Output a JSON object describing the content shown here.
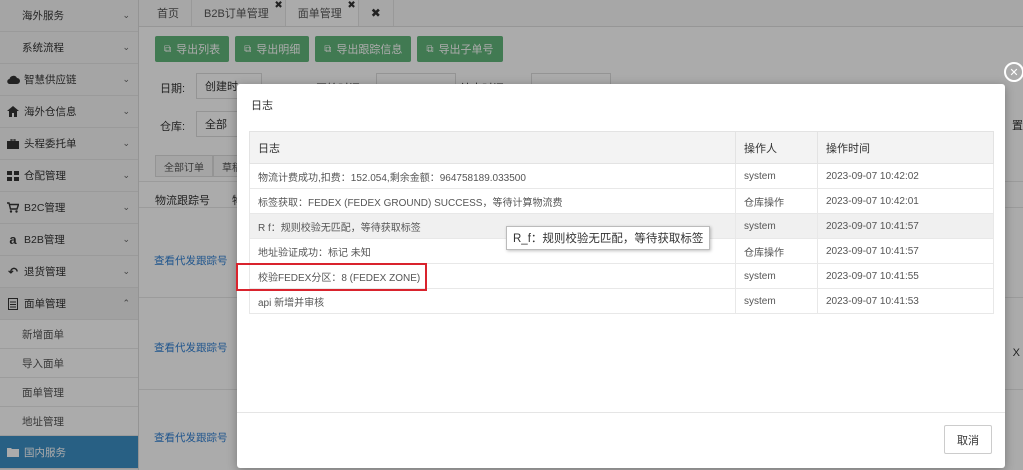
{
  "sidebar": {
    "items": [
      {
        "label": "海外服务",
        "icon": "none"
      },
      {
        "label": "系统流程",
        "icon": "none"
      },
      {
        "label": "智慧供应链",
        "icon": "cloud-icon"
      },
      {
        "label": "海外仓信息",
        "icon": "home-icon"
      },
      {
        "label": "头程委托单",
        "icon": "briefcase-icon"
      },
      {
        "label": "仓配管理",
        "icon": "grid-icon"
      },
      {
        "label": "B2C管理",
        "icon": "cart-icon"
      },
      {
        "label": "B2B管理",
        "icon": "amazon-icon"
      },
      {
        "label": "退货管理",
        "icon": "undo-icon"
      },
      {
        "label": "面单管理",
        "icon": "document-icon"
      }
    ],
    "subitems": [
      "新增面单",
      "导入面单",
      "面单管理",
      "地址管理"
    ],
    "active_item": {
      "label": "国内服务",
      "icon": "folder-icon"
    }
  },
  "tabs": [
    {
      "label": "首页",
      "closable": false
    },
    {
      "label": "B2B订单管理",
      "closable": true
    },
    {
      "label": "面单管理",
      "closable": true
    },
    {
      "label": "",
      "closable": true
    }
  ],
  "toolbar": {
    "buttons": [
      "导出列表",
      "导出明细",
      "导出跟踪信息",
      "导出子单号"
    ]
  },
  "filters": {
    "date_label": "日期:",
    "date_value": "创建时",
    "start_label": "开始时间",
    "end_label": "结束时间",
    "warehouse_label": "仓库:",
    "warehouse_value": "全部"
  },
  "subtabs": [
    "全部订单",
    "草稿"
  ],
  "list": {
    "col_tracking": "物流跟踪号",
    "col_partial": "物",
    "link_text": "查看代发跟踪号",
    "right_text_1": "置",
    "right_text_2": "X"
  },
  "modal": {
    "title": "日志",
    "headers": {
      "log": "日志",
      "operator": "操作人",
      "time": "操作时间"
    },
    "rows": [
      {
        "log": "物流计费成功,扣费：152.054,剩余金额：964758189.033500",
        "operator": "system",
        "time": "2023-09-07 10:42:02"
      },
      {
        "log": "标签获取：FEDEX (FEDEX GROUND) SUCCESS，等待计算物流费",
        "operator": "仓库操作",
        "time": "2023-09-07 10:42:01"
      },
      {
        "log": "R f：规则校验无匹配，等待获取标签",
        "operator": "system",
        "time": "2023-09-07 10:41:57"
      },
      {
        "log": "地址验证成功：标记 未知",
        "operator": "仓库操作",
        "time": "2023-09-07 10:41:57"
      },
      {
        "log": "校验FEDEX分区：8 (FEDEX ZONE)",
        "operator": "system",
        "time": "2023-09-07 10:41:55"
      },
      {
        "log": "api 新增并审核",
        "operator": "system",
        "time": "2023-09-07 10:41:53"
      }
    ],
    "tooltip": "R_f：规则校验无匹配，等待获取标签",
    "cancel_label": "取消"
  }
}
